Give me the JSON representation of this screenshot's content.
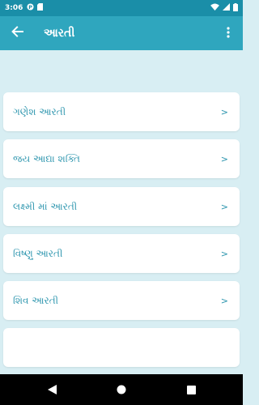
{
  "status_bar": {
    "time": "3:06"
  },
  "app_bar": {
    "title": "આરતી"
  },
  "list": {
    "items": [
      {
        "label": "ગણેશ આરતી",
        "chevron": ">"
      },
      {
        "label": "જય આદ્યા શક્તિ",
        "chevron": ">"
      },
      {
        "label": "લક્ષ્મી માં આરતી",
        "chevron": ">"
      },
      {
        "label": "વિષ્ણુ આરતી",
        "chevron": ">"
      },
      {
        "label": "શિવ આરતી",
        "chevron": ">"
      }
    ]
  },
  "colors": {
    "status_bar": "#1a8ea8",
    "app_bar": "#2fa6be",
    "background": "#d8eef3",
    "item_text": "#2a94ad"
  },
  "icons": {
    "back": "arrow-left-icon",
    "menu": "more-vert-icon",
    "nav_back": "triangle-back-icon",
    "nav_home": "circle-home-icon",
    "nav_recents": "square-recents-icon"
  }
}
